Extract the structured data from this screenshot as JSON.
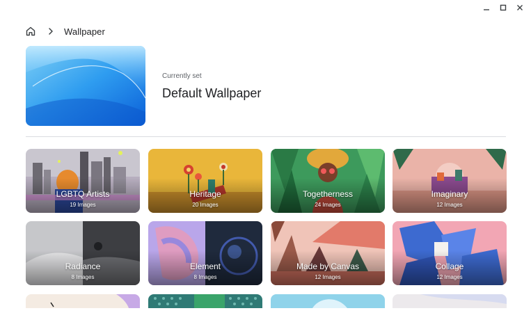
{
  "window": {
    "controls": {
      "minimize": "minimize",
      "maximize": "maximize",
      "close": "close"
    }
  },
  "breadcrumb": {
    "home_icon": "home-icon",
    "separator_icon": "chevron-right-icon",
    "title": "Wallpaper"
  },
  "current": {
    "label": "Currently set",
    "name": "Default Wallpaper"
  },
  "collections": [
    {
      "name": "LGBTQ Artists",
      "count": "19 Images"
    },
    {
      "name": "Heritage",
      "count": "20 Images"
    },
    {
      "name": "Togetherness",
      "count": "24 Images"
    },
    {
      "name": "Imaginary",
      "count": "12 Images"
    },
    {
      "name": "Radiance",
      "count": "8 Images"
    },
    {
      "name": "Element",
      "count": "8 Images"
    },
    {
      "name": "Made by Canvas",
      "count": "12 Images"
    },
    {
      "name": "Collage",
      "count": "12 Images"
    }
  ],
  "colors": {
    "divider": "#dadce0",
    "text_primary": "#202124",
    "text_secondary": "#5f6368"
  }
}
